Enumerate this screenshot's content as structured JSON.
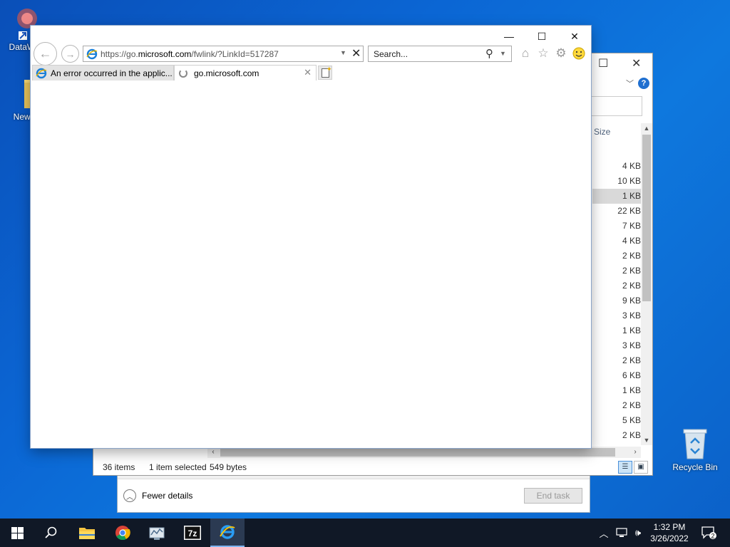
{
  "desktop": {
    "icons": [
      {
        "label": "DataWa"
      },
      {
        "label": "New f"
      }
    ],
    "recycle_bin": "Recycle Bin"
  },
  "task_manager": {
    "fewer_details": "Fewer details",
    "end_task": "End task"
  },
  "explorer": {
    "size_header": "Size",
    "sizes": [
      "4 KB",
      "10 KB",
      "1 KB",
      "22 KB",
      "7 KB",
      "4 KB",
      "2 KB",
      "2 KB",
      "2 KB",
      "9 KB",
      "3 KB",
      "1 KB",
      "3 KB",
      "2 KB",
      "6 KB",
      "1 KB",
      "2 KB",
      "5 KB",
      "2 KB"
    ],
    "selected_index": 2,
    "status": {
      "items": "36 items",
      "selected": "1 item selected",
      "bytes": "549 bytes"
    }
  },
  "browser": {
    "address": {
      "prefix": "https://go.",
      "domain": "microsoft.com",
      "suffix": "/fwlink/?LinkId=517287"
    },
    "search_placeholder": "Search...",
    "tabs": [
      {
        "label": "An error occurred in the applic..."
      },
      {
        "label": "go.microsoft.com"
      }
    ]
  },
  "taskbar": {
    "time": "1:32 PM",
    "date": "3/26/2022",
    "notification_count": "2",
    "apps": [
      "file-explorer",
      "chrome",
      "network-app",
      "7zip",
      "internet-explorer"
    ]
  }
}
